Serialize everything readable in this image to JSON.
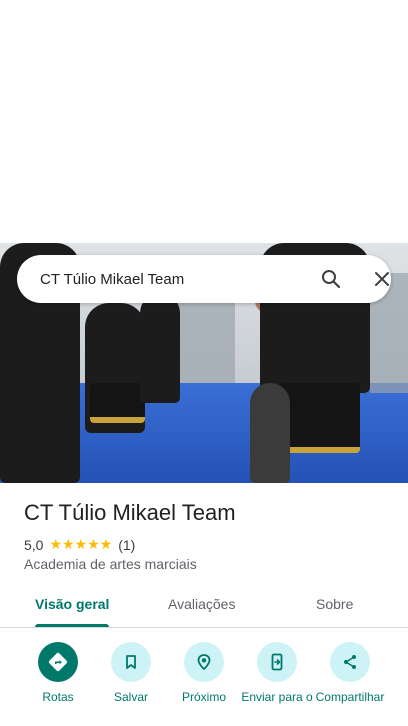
{
  "search": {
    "query": "CT Túlio Mikael Team"
  },
  "place": {
    "title": "CT Túlio Mikael Team",
    "rating": "5,0",
    "stars": "★★★★★",
    "review_count": "(1)",
    "category": "Academia de artes marciais"
  },
  "tabs": [
    {
      "label": "Visão geral",
      "active": true
    },
    {
      "label": "Avaliações",
      "active": false
    },
    {
      "label": "Sobre",
      "active": false
    }
  ],
  "actions": [
    {
      "label": "Rotas",
      "icon": "directions-icon"
    },
    {
      "label": "Salvar",
      "icon": "bookmark-icon"
    },
    {
      "label": "Próximo",
      "icon": "nearby-icon"
    },
    {
      "label": "Enviar para o",
      "icon": "send-to-phone-icon"
    },
    {
      "label": "Compartilhar",
      "icon": "share-icon"
    }
  ],
  "colors": {
    "accent": "#00796b",
    "action_bg": "#cdf3f7",
    "star": "#fbbc04"
  }
}
